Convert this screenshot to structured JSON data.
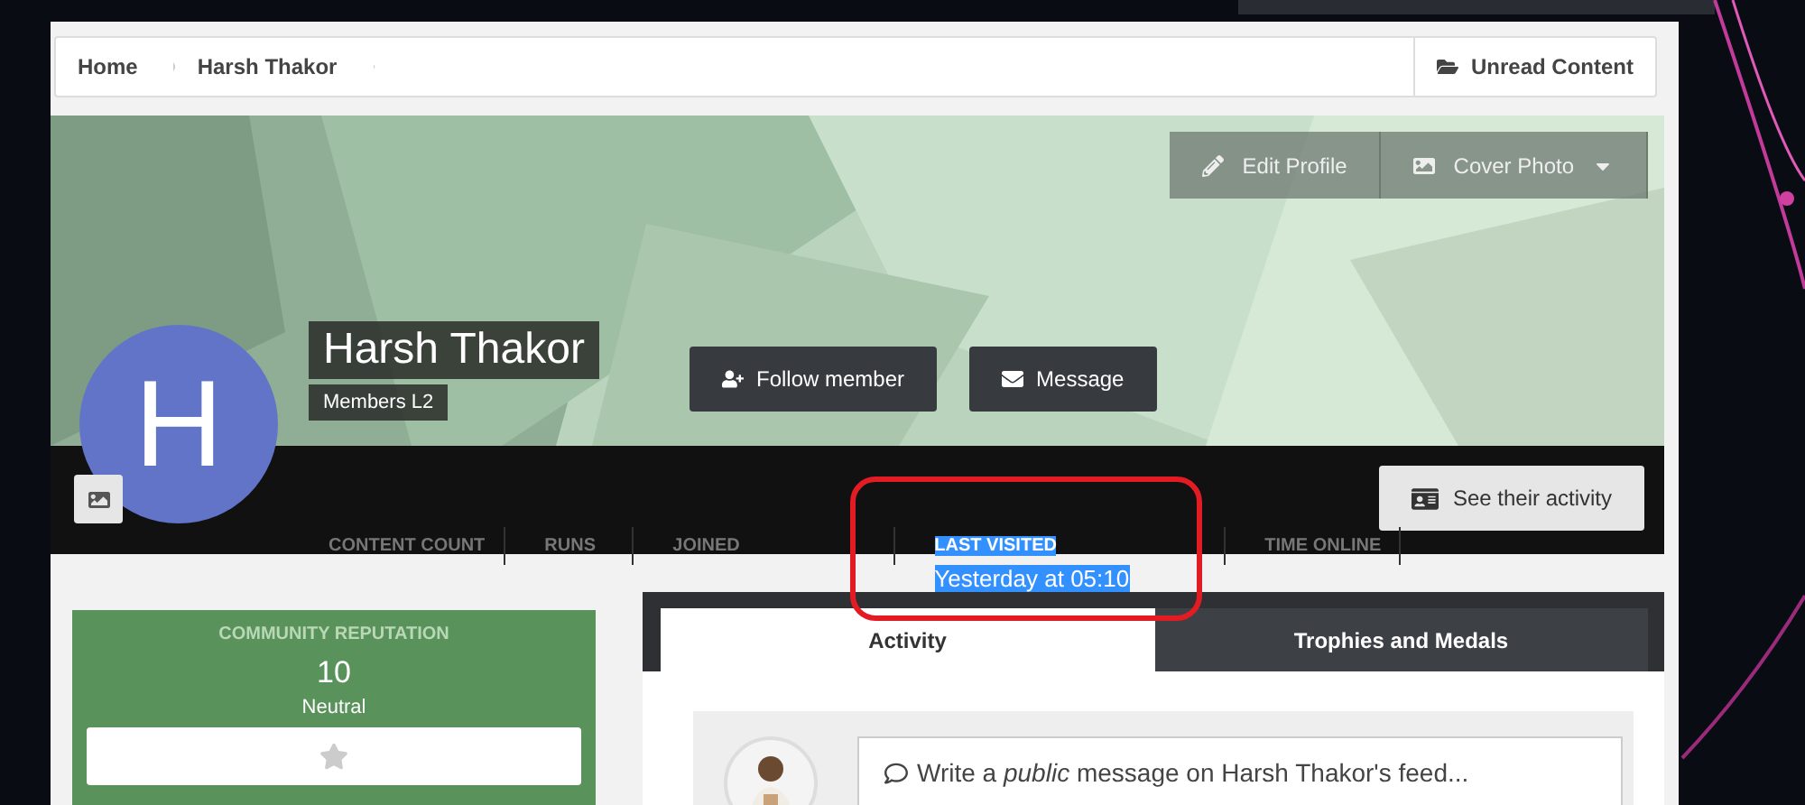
{
  "breadcrumb": [
    {
      "label": "Home"
    },
    {
      "label": "Harsh Thakor"
    }
  ],
  "unread_link": {
    "label": "Unread Content"
  },
  "cover_actions": [
    {
      "label": "Edit Profile",
      "kind": "edit"
    },
    {
      "label": "Cover Photo"
    }
  ],
  "profile": {
    "avatar_letter": "H",
    "name": "Harsh Thakor",
    "group": "Members L2"
  },
  "actions": [
    {
      "label": "Follow member",
      "kind": "follow"
    },
    {
      "label": "Message",
      "kind": "message"
    }
  ],
  "activity_button": {
    "label": "See their activity"
  },
  "stats": [
    {
      "label": "CONTENT COUNT",
      "highlighted": false
    },
    {
      "label": "RUNS",
      "highlighted": false
    },
    {
      "label": "JOINED",
      "highlighted": false
    },
    {
      "label": "LAST VISITED",
      "value": "Yesterday at 05:10",
      "highlighted": true
    },
    {
      "label": "TIME ONLINE",
      "highlighted": false
    }
  ],
  "reputation": {
    "title": "COMMUNITY REPUTATION",
    "score": "10",
    "rank": "Neutral"
  },
  "tabs": [
    {
      "label": "Activity",
      "selected": true
    },
    {
      "label": "Trophies and Medals",
      "selected": false
    }
  ],
  "composer": {
    "prompt": "Write a *public* message on Harsh Thakor's feed..."
  }
}
